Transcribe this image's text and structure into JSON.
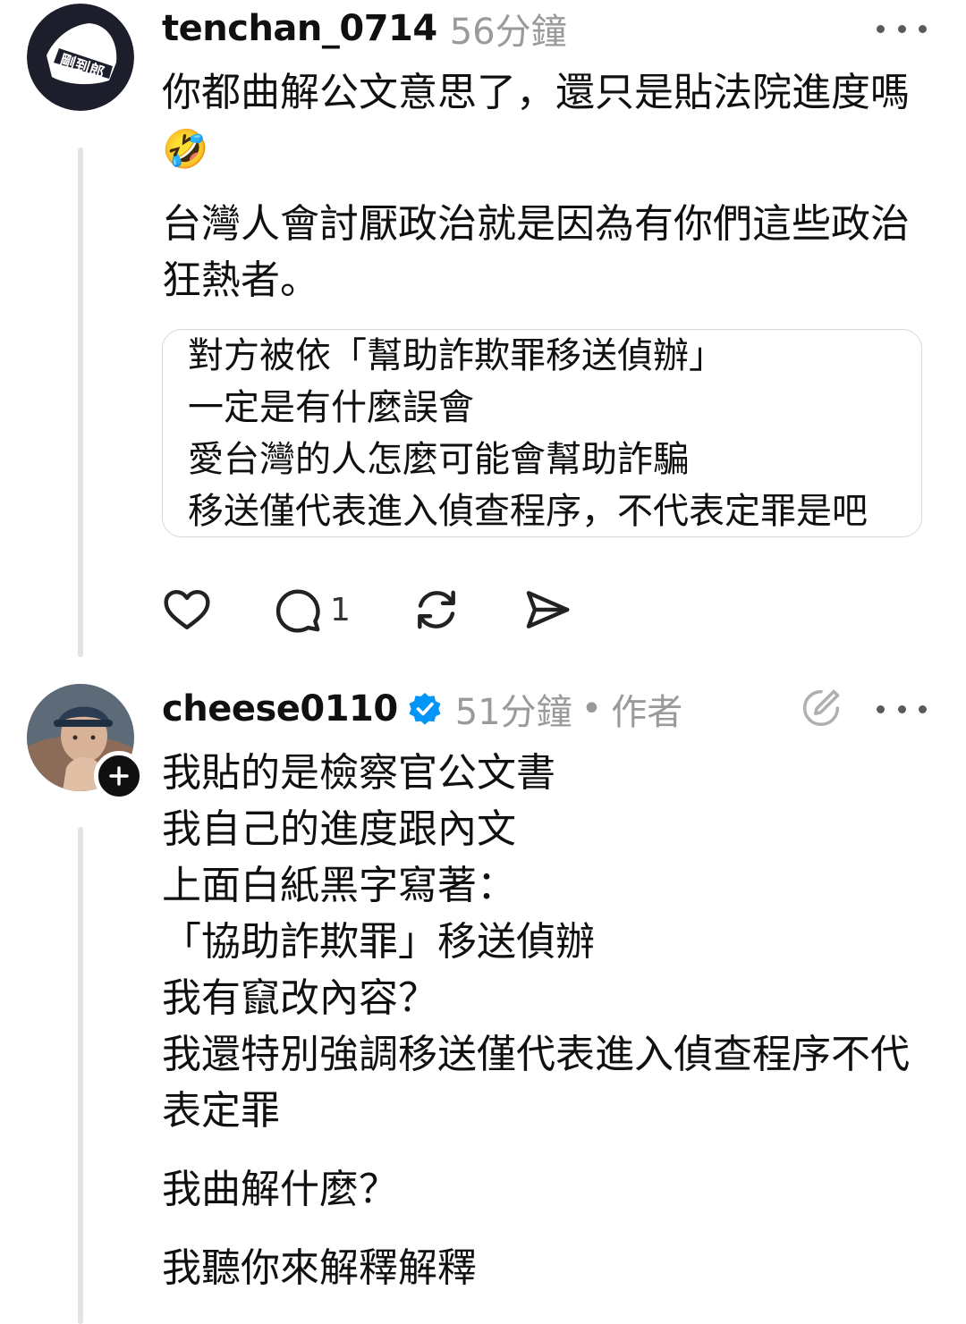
{
  "post1": {
    "username": "tenchan_0714",
    "time": "56分鐘",
    "paragraphs": [
      "你都曲解公文意思了，還只是貼法院進度嗎",
      "台灣人會討厭政治就是因為有你們這些政治狂熱者。"
    ],
    "emoji": "🤣",
    "avatar_text": "剛到郎",
    "quote_lines": [
      "對方被依「幫助詐欺罪移送偵辦」",
      "一定是有什麼誤會",
      "愛台灣的人怎麼可能會幫助詐騙",
      "移送僅代表進入偵查程序，不代表定罪是吧"
    ],
    "actions": {
      "like_icon": "heart-icon",
      "reply_icon": "comment-icon",
      "reply_count": "1",
      "repost_icon": "repost-icon",
      "share_icon": "send-icon"
    }
  },
  "post2": {
    "username": "cheese0110",
    "time": "51分鐘",
    "separator": "•",
    "author_label": "作者",
    "verified_icon": "verified-badge-icon",
    "edit_icon": "edit-icon",
    "follow_icon": "plus-icon",
    "lines": [
      "我貼的是檢察官公文書",
      "我自己的進度跟內文",
      "上面白紙黑字寫著：",
      "「協助詐欺罪」移送偵辦",
      "我有竄改內容？",
      "我還特別強調移送僅代表進入偵查程序不代表定罪"
    ],
    "question": "我曲解什麼？",
    "closing": "我聽你來解釋解釋"
  },
  "colors": {
    "text": "#101010",
    "muted": "#9a9a9a",
    "verified": "#0095f6",
    "thread_line": "#e3e3e3"
  }
}
